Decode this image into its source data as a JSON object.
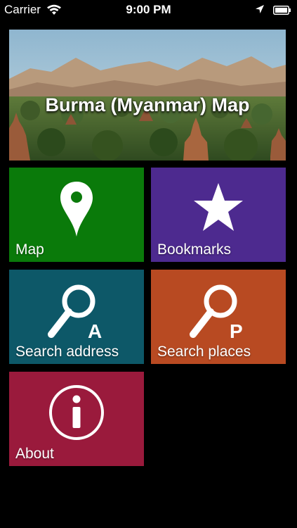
{
  "status_bar": {
    "carrier": "Carrier",
    "time": "9:00 PM",
    "icons": [
      "wifi-icon",
      "location-arrow-icon",
      "battery-icon"
    ]
  },
  "banner": {
    "title": "Burma (Myanmar) Map"
  },
  "tiles": [
    {
      "label": "Map",
      "icon": "map-pin-icon",
      "color": "#0a7a0a"
    },
    {
      "label": "Bookmarks",
      "icon": "star-icon",
      "color": "#4d2a8f"
    },
    {
      "label": "Search address",
      "icon": "search-address-icon",
      "icon_letter": "A",
      "color": "#0d5868"
    },
    {
      "label": "Search places",
      "icon": "search-places-icon",
      "icon_letter": "P",
      "color": "#b84a22"
    },
    {
      "label": "About",
      "icon": "info-icon",
      "color": "#9a1a3c"
    }
  ]
}
